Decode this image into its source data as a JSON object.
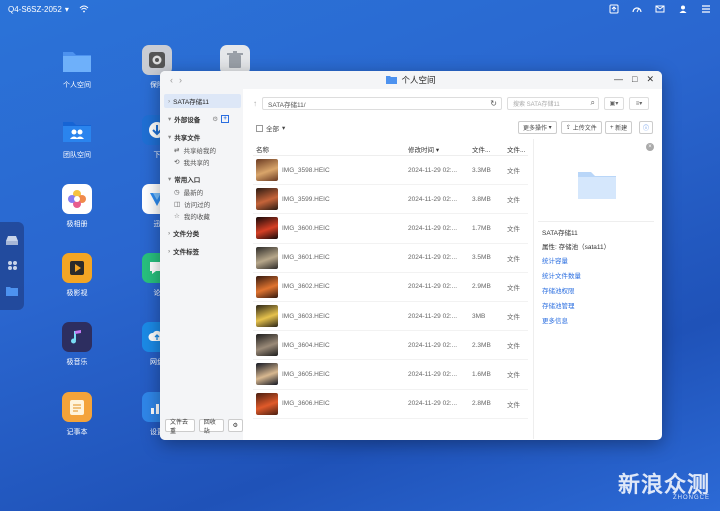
{
  "topbar": {
    "device_name": "Q4-S6SZ-2052",
    "icons": [
      "wifi-icon",
      "upload-icon",
      "speed-icon",
      "message-icon",
      "user-icon",
      "menu-icon"
    ]
  },
  "desktop": {
    "icons": [
      {
        "label": "个人空间",
        "icon": "folder-icon",
        "color": "#5aa2f4"
      },
      {
        "label": "保险",
        "icon": "safe-icon",
        "color": "#c9ccd3"
      },
      {
        "label": "",
        "icon": "trash-icon",
        "color": "#e5e7ea"
      },
      {
        "label": "团队空间",
        "icon": "team-folder-icon",
        "color": "#1e78e6"
      },
      {
        "label": "下",
        "icon": "download-icon",
        "color": "#1f6fd4"
      },
      {
        "label": "极相册",
        "icon": "photos-icon",
        "color": "#ffffff"
      },
      {
        "label": "迅",
        "icon": "xunlei-icon",
        "color": "#ffffff"
      },
      {
        "label": "极影视",
        "icon": "video-icon",
        "color": "#f3a524"
      },
      {
        "label": "论",
        "icon": "forum-icon",
        "color": "#28c07e"
      },
      {
        "label": "极音乐",
        "icon": "music-icon",
        "color": "#2d2e60"
      },
      {
        "label": "网盘",
        "icon": "cloud-icon",
        "color": "#1b8ae6"
      },
      {
        "label": "记事本",
        "icon": "notes-icon",
        "color": "#f4a33a"
      },
      {
        "label": "设置",
        "icon": "settings-icon",
        "color": "#2f86e8"
      }
    ]
  },
  "window": {
    "title": "个人空间",
    "sidebar": {
      "selected": "SATA存储11",
      "groups": [
        {
          "label": "外部设备",
          "items": []
        },
        {
          "label": "共享文件",
          "items": [
            "共享给我的",
            "我共享的"
          ]
        },
        {
          "label": "常用入口",
          "items": [
            "最新的",
            "访问过的",
            "我的收藏"
          ]
        },
        {
          "label": "文件分类",
          "items": []
        },
        {
          "label": "文件标签",
          "items": []
        }
      ],
      "bottom": [
        "文件去重",
        "回收站"
      ]
    },
    "path": "SATA存储11/",
    "search_placeholder": "搜索 SATA存储11",
    "select_all": "全部",
    "buttons": {
      "more": "更多操作",
      "upload": "上传文件",
      "new": "新建"
    },
    "columns": [
      "名称",
      "修改时间",
      "文件...",
      "文件..."
    ],
    "files": [
      {
        "name": "IMG_3598.HEIC",
        "time": "2024-11-29 02:...",
        "size": "3.3MB",
        "type": "文件",
        "c1": "#6a3a22",
        "c2": "#d9a56a"
      },
      {
        "name": "IMG_3599.HEIC",
        "time": "2024-11-29 02:...",
        "size": "3.8MB",
        "type": "文件",
        "c1": "#2a1a12",
        "c2": "#c5643a"
      },
      {
        "name": "IMG_3600.HEIC",
        "time": "2024-11-29 02:...",
        "size": "1.7MB",
        "type": "文件",
        "c1": "#140808",
        "c2": "#d64025"
      },
      {
        "name": "IMG_3601.HEIC",
        "time": "2024-11-29 02:...",
        "size": "3.5MB",
        "type": "文件",
        "c1": "#2c2a28",
        "c2": "#b7a78a"
      },
      {
        "name": "IMG_3602.HEIC",
        "time": "2024-11-29 02:...",
        "size": "2.9MB",
        "type": "文件",
        "c1": "#33180e",
        "c2": "#e07430"
      },
      {
        "name": "IMG_3603.HEIC",
        "time": "2024-11-29 02:...",
        "size": "3MB",
        "type": "文件",
        "c1": "#2a2416",
        "c2": "#e6c24d"
      },
      {
        "name": "IMG_3604.HEIC",
        "time": "2024-11-29 02:...",
        "size": "2.3MB",
        "type": "文件",
        "c1": "#1c1c1c",
        "c2": "#9a8a78"
      },
      {
        "name": "IMG_3605.HEIC",
        "time": "2024-11-29 02:...",
        "size": "1.6MB",
        "type": "文件",
        "c1": "#121622",
        "c2": "#d8b890"
      },
      {
        "name": "IMG_3606.HEIC",
        "time": "2024-11-29 02:...",
        "size": "2.8MB",
        "type": "文件",
        "c1": "#4a1e10",
        "c2": "#e05a2a"
      }
    ],
    "details": {
      "name": "SATA存储11",
      "attribute": "属性: 存储池（sata11）",
      "links": [
        "统计容量",
        "统计文件数量",
        "存储池权限",
        "存储池管理",
        "更多信息"
      ]
    }
  },
  "watermark": {
    "text": "新浪众测",
    "sub": "ZHONGCE"
  }
}
